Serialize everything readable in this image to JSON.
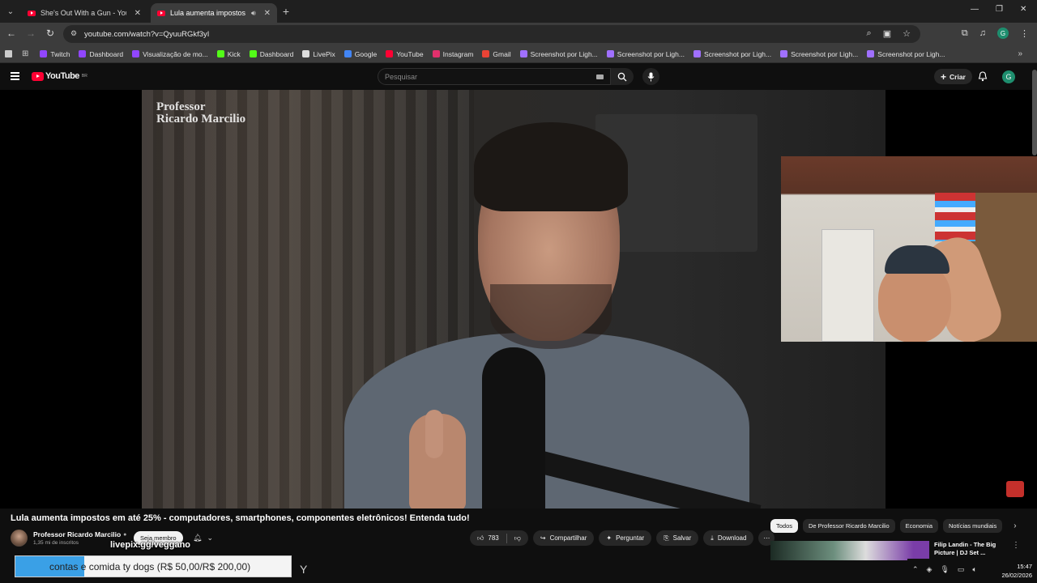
{
  "browser": {
    "tabs": [
      {
        "title": "She's Out With a Gun - YouTub",
        "active": false
      },
      {
        "title": "Lula aumenta impostos em",
        "active": true
      }
    ],
    "url": "youtube.com/watch?v=QyuuRGkf3yI",
    "bookmarks": [
      {
        "label": "Twitch",
        "color": "#9146ff"
      },
      {
        "label": "Dashboard",
        "color": "#9146ff"
      },
      {
        "label": "Visualização de mo...",
        "color": "#9146ff"
      },
      {
        "label": "Kick",
        "color": "#53fc18"
      },
      {
        "label": "Dashboard",
        "color": "#53fc18"
      },
      {
        "label": "LivePix",
        "color": "#dddddd"
      },
      {
        "label": "Google",
        "color": "#4285f4"
      },
      {
        "label": "YouTube",
        "color": "#ff0033"
      },
      {
        "label": "Instagram",
        "color": "#e1306c"
      },
      {
        "label": "Gmail",
        "color": "#ea4335"
      },
      {
        "label": "Screenshot por Ligh...",
        "color": "#a070ff"
      },
      {
        "label": "Screenshot por Ligh...",
        "color": "#a070ff"
      },
      {
        "label": "Screenshot por Ligh...",
        "color": "#a070ff"
      },
      {
        "label": "Screenshot por Ligh...",
        "color": "#a070ff"
      },
      {
        "label": "Screenshot por Ligh...",
        "color": "#a070ff"
      }
    ],
    "profile_initial": "G"
  },
  "youtube": {
    "logo_text": "YouTube",
    "logo_badge": "BR",
    "search_placeholder": "Pesquisar",
    "create_label": "Criar",
    "avatar_initial": "G"
  },
  "video": {
    "watermark_line1": "Professor",
    "watermark_line2": "Ricardo Marcilio",
    "title": "Lula aumenta impostos em até 25% - computadores, smartphones, componentes eletrônicos! Entenda tudo!"
  },
  "channel": {
    "name": "Professor Ricardo Marcilio",
    "subscribers": "1,35 mi de inscritos",
    "member_label": "Seja membro"
  },
  "actions": {
    "likes": "783",
    "share": "Compartilhar",
    "ask": "Perguntar",
    "save": "Salvar",
    "download": "Download"
  },
  "chips": [
    "Todos",
    "De Professor Ricardo Marcilio",
    "Economia",
    "Notícias mundiais"
  ],
  "recommendation": {
    "title": "Filip Landin - The Big Picture | DJ Set ..."
  },
  "overlay": {
    "livepix_url": "livepix.gg/veggano",
    "donation_text": "contas e comida ty dogs (R$ 50,00/R$ 200,00)",
    "donation_progress": 0.25,
    "accent_color": "#3aa0e6"
  },
  "taskbar": {
    "time": "15:47",
    "date": "26/02/2026"
  }
}
